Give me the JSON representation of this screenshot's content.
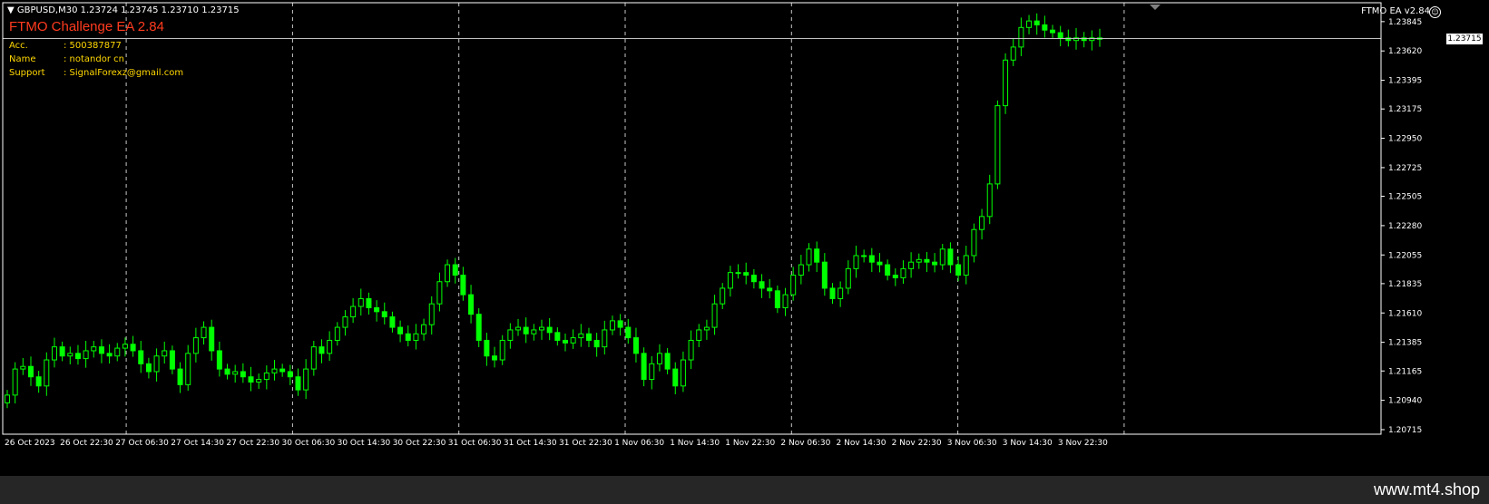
{
  "header": {
    "symbol_info": "GBPUSD,M30  1.23724 1.23745 1.23710 1.23715",
    "ea_title": "FTMO Challenge EA 2.84",
    "info_rows": [
      {
        "label": "Acc.",
        "value": ": 500387877"
      },
      {
        "label": "Name",
        "value": ": notandor cn"
      },
      {
        "label": "Support",
        "value": ": SignalForexz@gmail.com"
      }
    ],
    "ea_badge": "FTMO EA  v2.84",
    "ea_badge_icon": "smiley-icon"
  },
  "current_price": "1.23715",
  "watermark": "www.mt4.shop",
  "colors": {
    "background": "#000000",
    "candle": "#00ff00",
    "grid": "#c8c8c8",
    "title": "#ff3b1f",
    "info": "#ffd700",
    "price_line": "#c0c0c0"
  },
  "chart_data": {
    "type": "candlestick",
    "symbol": "GBPUSD",
    "timeframe": "M30",
    "ylim": [
      1.2068,
      1.2399
    ],
    "y_ticks": [
      "1.23845",
      "1.23620",
      "1.23395",
      "1.23175",
      "1.22950",
      "1.22725",
      "1.22505",
      "1.22280",
      "1.22055",
      "1.21835",
      "1.21610",
      "1.21385",
      "1.21165",
      "1.20940",
      "1.20715"
    ],
    "x_ticks": [
      "26 Oct 2023",
      "26 Oct 22:30",
      "27 Oct 06:30",
      "27 Oct 14:30",
      "27 Oct 22:30",
      "30 Oct 06:30",
      "30 Oct 14:30",
      "30 Oct 22:30",
      "31 Oct 06:30",
      "31 Oct 14:30",
      "31 Oct 22:30",
      "1 Nov 06:30",
      "1 Nov 14:30",
      "1 Nov 22:30",
      "2 Nov 06:30",
      "2 Nov 14:30",
      "2 Nov 22:30",
      "3 Nov 06:30",
      "3 Nov 14:30",
      "3 Nov 22:30"
    ],
    "grid": "vertical-dashed",
    "series_close": [
      1.2098,
      1.2118,
      1.212,
      1.2112,
      1.2105,
      1.2125,
      1.2135,
      1.2128,
      1.213,
      1.2126,
      1.2132,
      1.2135,
      1.213,
      1.2128,
      1.2134,
      1.2137,
      1.2132,
      1.2122,
      1.2116,
      1.2128,
      1.2132,
      1.2118,
      1.2106,
      1.213,
      1.2142,
      1.215,
      1.2132,
      1.2118,
      1.2114,
      1.2116,
      1.2112,
      1.2108,
      1.211,
      1.2115,
      1.2118,
      1.2116,
      1.2112,
      1.2102,
      1.2118,
      1.2135,
      1.213,
      1.214,
      1.215,
      1.2158,
      1.2166,
      1.2172,
      1.2165,
      1.2162,
      1.2158,
      1.215,
      1.2145,
      1.214,
      1.2145,
      1.2152,
      1.2168,
      1.2185,
      1.2198,
      1.219,
      1.2175,
      1.216,
      1.214,
      1.2128,
      1.2125,
      1.214,
      1.2148,
      1.215,
      1.2145,
      1.2148,
      1.215,
      1.2146,
      1.214,
      1.2138,
      1.2142,
      1.2145,
      1.214,
      1.2135,
      1.2148,
      1.2155,
      1.215,
      1.2142,
      1.213,
      1.211,
      1.2122,
      1.213,
      1.2118,
      1.2105,
      1.2125,
      1.214,
      1.2148,
      1.215,
      1.2168,
      1.218,
      1.2192,
      1.2192,
      1.219,
      1.2185,
      1.218,
      1.2178,
      1.2165,
      1.2175,
      1.219,
      1.2198,
      1.221,
      1.22,
      1.218,
      1.2172,
      1.218,
      1.2195,
      1.2205,
      1.2205,
      1.22,
      1.2198,
      1.219,
      1.2188,
      1.2195,
      1.22,
      1.2202,
      1.22,
      1.2198,
      1.221,
      1.2198,
      1.219,
      1.2205,
      1.2225,
      1.2235,
      1.226,
      1.232,
      1.2355,
      1.2365,
      1.238,
      1.2385,
      1.2382,
      1.2378,
      1.2376,
      1.2372,
      1.237,
      1.2372,
      1.237,
      1.2372,
      1.2371
    ]
  }
}
